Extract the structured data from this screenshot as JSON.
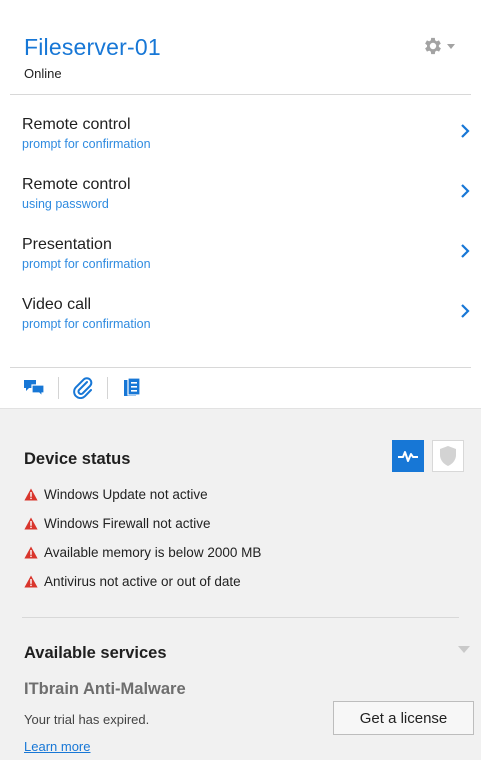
{
  "device": {
    "name": "Fileserver-01",
    "state": "Online"
  },
  "actions": [
    {
      "title": "Remote control",
      "subtitle": "prompt for confirmation"
    },
    {
      "title": "Remote control",
      "subtitle": "using password"
    },
    {
      "title": "Presentation",
      "subtitle": "prompt for confirmation"
    },
    {
      "title": "Video call",
      "subtitle": "prompt for confirmation"
    }
  ],
  "toolbar_icons": [
    "chat-icon",
    "attachment-icon",
    "clipboard-icon"
  ],
  "device_status": {
    "heading": "Device status",
    "warnings": [
      "Windows Update not active",
      "Windows Firewall not active",
      "Available memory is below 2000 MB",
      "Antivirus not active or out of date"
    ]
  },
  "services": {
    "heading": "Available services",
    "service_name": "ITbrain Anti-Malware",
    "note": "Your trial has expired.",
    "button_label": "Get a license",
    "link_label": "Learn more"
  },
  "colors": {
    "accent": "#1777d6",
    "subtext": "#2f8be0",
    "warning": "#d9352c"
  }
}
